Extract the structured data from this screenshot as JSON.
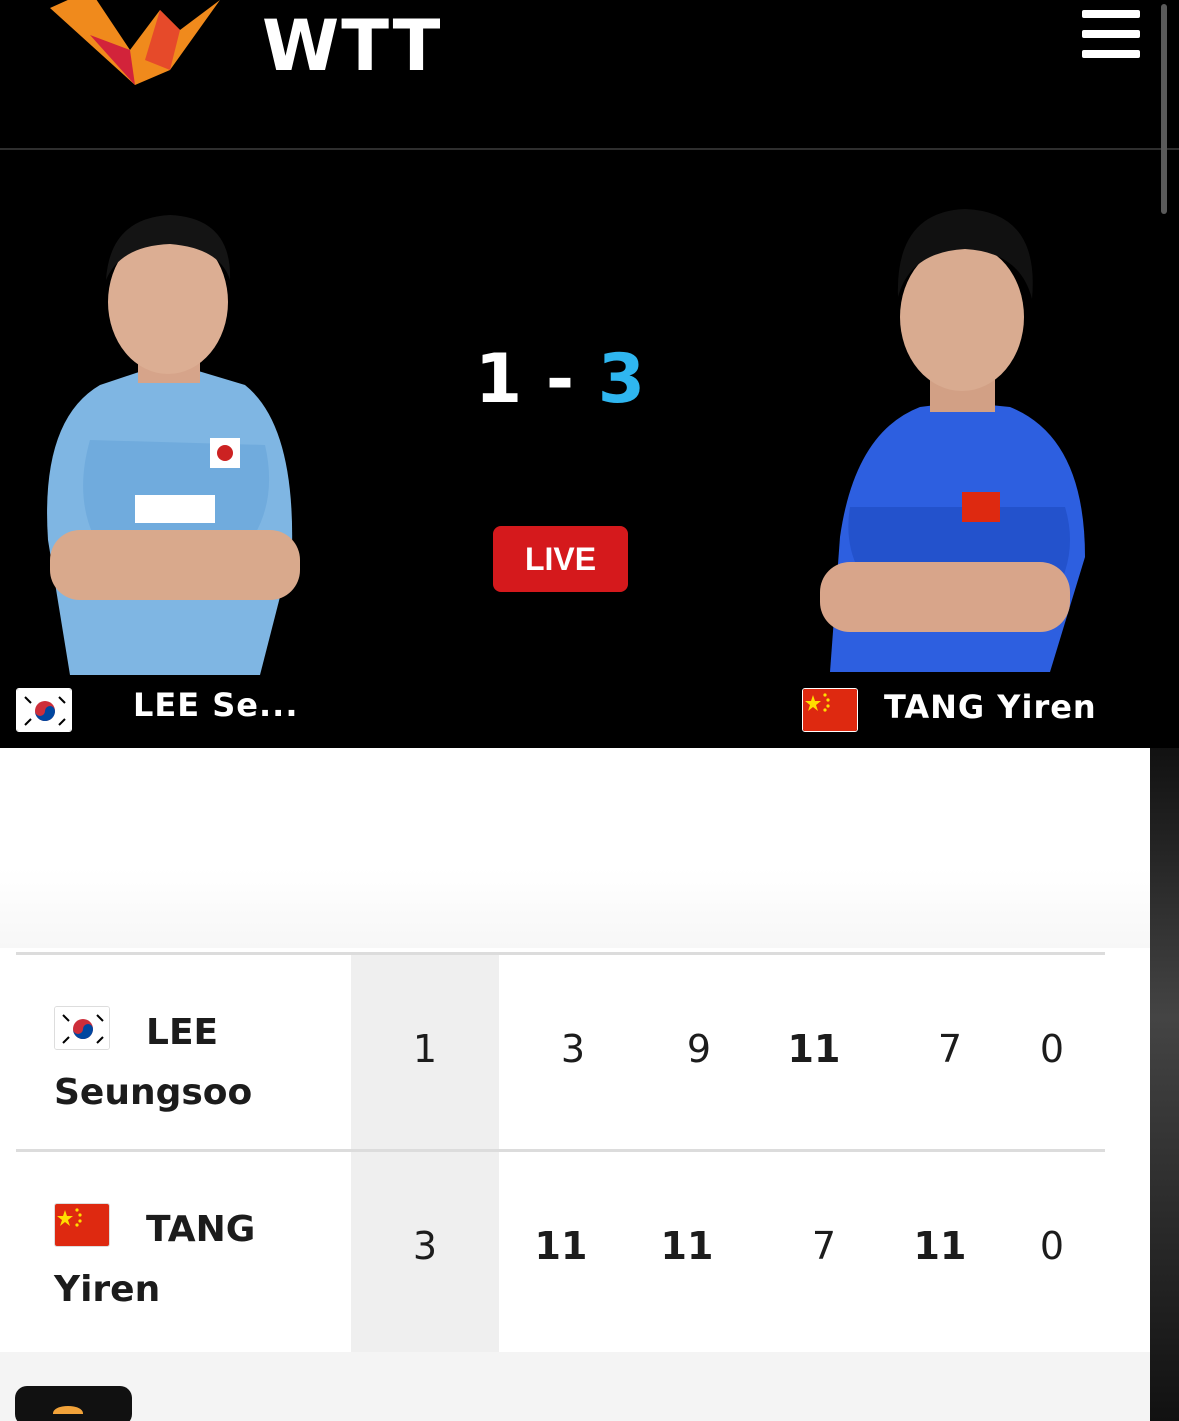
{
  "header": {
    "logo_text": "WTT",
    "menu_icon": "hamburger-menu-icon"
  },
  "match": {
    "score_left": "1",
    "score_separator": "-",
    "score_right": "3",
    "status": "LIVE",
    "status_color": "#d5191c",
    "winner_accent": "#2fb6f0"
  },
  "players": [
    {
      "hero_name": "LEE Se...",
      "first_line": "LEE",
      "second_line": "Seungsoo",
      "flag": "south-korea-flag-icon",
      "match": "1",
      "games": [
        "3",
        "9",
        "11",
        "7",
        "0"
      ]
    },
    {
      "hero_name": "TANG Yiren",
      "first_line": "TANG",
      "second_line": "Yiren",
      "flag": "china-flag-icon",
      "match": "3",
      "games": [
        "11",
        "11",
        "7",
        "11",
        "0"
      ]
    }
  ]
}
